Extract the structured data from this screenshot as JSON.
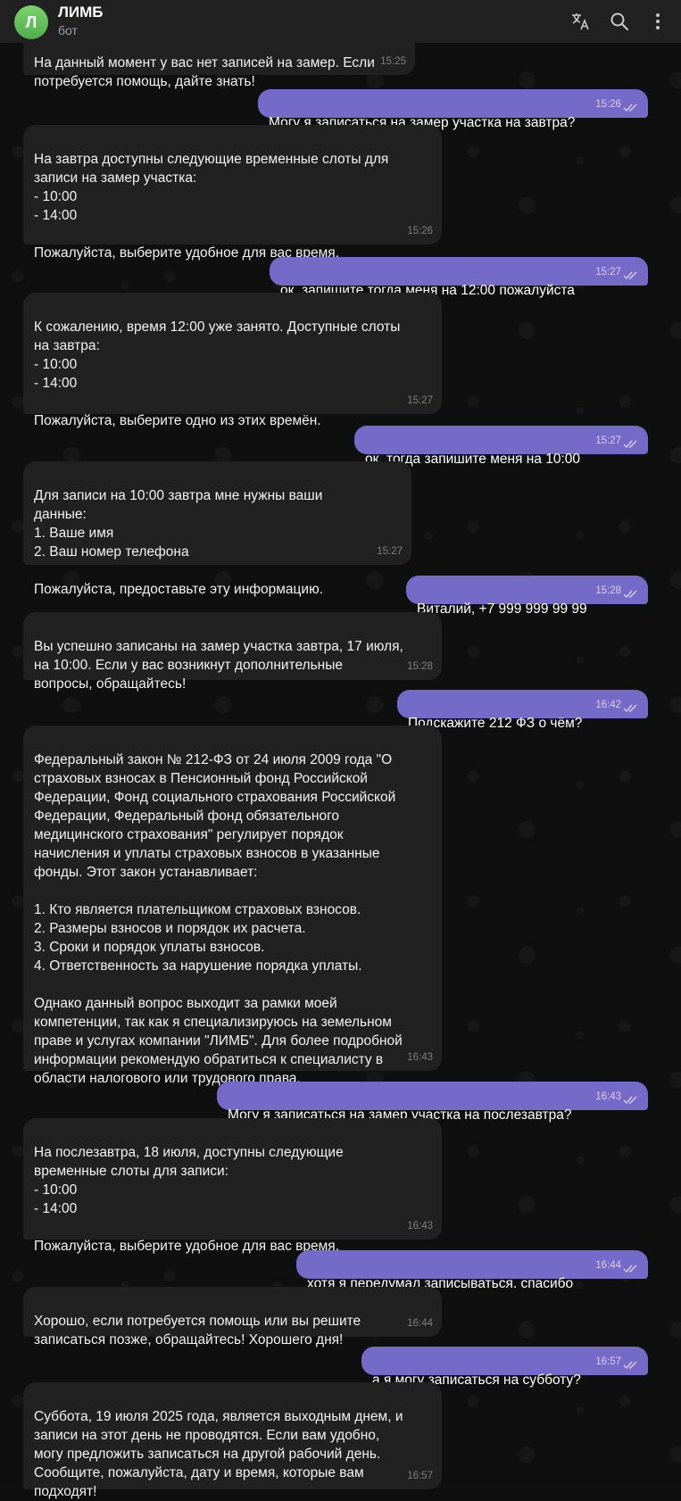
{
  "header": {
    "avatar_letter": "Л",
    "title": "ЛИМБ",
    "subtitle": "бот",
    "icons": [
      "translate-icon",
      "search-icon",
      "more-vert-icon"
    ]
  },
  "colors": {
    "outgoing": "#766ac8",
    "incoming": "#212121",
    "header": "#212121",
    "avatar": "#5cbd55"
  },
  "messages": [
    {
      "dir": "in",
      "text": "На данный момент у вас нет записей на замер. Если потребуется помощь, дайте знать!",
      "time": "15:25"
    },
    {
      "dir": "out",
      "text": "Могу я записаться на замер участка на завтра?",
      "time": "15:26"
    },
    {
      "dir": "in",
      "text": "На завтра доступны следующие временные слоты для записи на замер участка:\n- 10:00\n- 14:00\n\nПожалуйста, выберите удобное для вас время.",
      "time": "15:26"
    },
    {
      "dir": "out",
      "text": "ок. запишите тогда меня на 12:00 пожалуйста",
      "time": "15:27"
    },
    {
      "dir": "in",
      "text": "К сожалению, время 12:00 уже занято. Доступные слоты на завтра:\n- 10:00\n- 14:00\n\nПожалуйста, выберите одно из этих времён.",
      "time": "15:27"
    },
    {
      "dir": "out",
      "text": "ок. тогда запишите меня на 10:00",
      "time": "15:27"
    },
    {
      "dir": "in",
      "text": "Для записи на 10:00 завтра мне нужны ваши данные:\n1. Ваше имя\n2. Ваш номер телефона\n\nПожалуйста, предоставьте эту информацию.",
      "time": "15:27"
    },
    {
      "dir": "out",
      "text": "Виталий, +7 999 999 99 99",
      "time": "15:28"
    },
    {
      "dir": "in",
      "text": "Вы успешно записаны на замер участка завтра, 17 июля, на 10:00. Если у вас возникнут дополнительные вопросы, обращайтесь!",
      "time": "15:28"
    },
    {
      "dir": "out",
      "text": "Подскажите 212 ФЗ о чём?",
      "time": "16:42"
    },
    {
      "dir": "in",
      "text": "Федеральный закон № 212-ФЗ от 24 июля 2009 года \"О страховых взносах в Пенсионный фонд Российской Федерации, Фонд социального страхования Российской Федерации, Федеральный фонд обязательного медицинского страхования\" регулирует порядок начисления и уплаты страховых взносов в указанные фонды. Этот закон устанавливает:\n\n1. Кто является плательщиком страховых взносов.\n2. Размеры взносов и порядок их расчета.\n3. Сроки и порядок уплаты взносов.\n4. Ответственность за нарушение порядка уплаты.\n\nОднако данный вопрос выходит за рамки моей компетенции, так как я специализируюсь на земельном праве и услугах компании \"ЛИМБ\". Для более подробной информации рекомендую обратиться к специалисту в области налогового или трудового права.",
      "time": "16:43"
    },
    {
      "dir": "out",
      "text": "Могу я записаться на замер участка на послезавтра?",
      "time": "16:43"
    },
    {
      "dir": "in",
      "text": "На послезавтра, 18 июля, доступны следующие временные слоты для записи:\n- 10:00\n- 14:00\n\nПожалуйста, выберите удобное для вас время.",
      "time": "16:43"
    },
    {
      "dir": "out",
      "text": "хотя я передумал записываться. спасибо",
      "time": "16:44"
    },
    {
      "dir": "in",
      "text": "Хорошо, если потребуется помощь или вы решите записаться позже, обращайтесь! Хорошего дня!",
      "time": "16:44"
    },
    {
      "dir": "out",
      "text": "а я могу записаться на субботу?",
      "time": "16:57"
    },
    {
      "dir": "in",
      "text": "Суббота, 19 июля 2025 года, является выходным днем, и записи на этот день не проводятся. Если вам удобно, могу предложить записаться на другой рабочий день. Сообщите, пожалуйста, дату и время, которые вам подходят!",
      "time": "16:57"
    }
  ]
}
